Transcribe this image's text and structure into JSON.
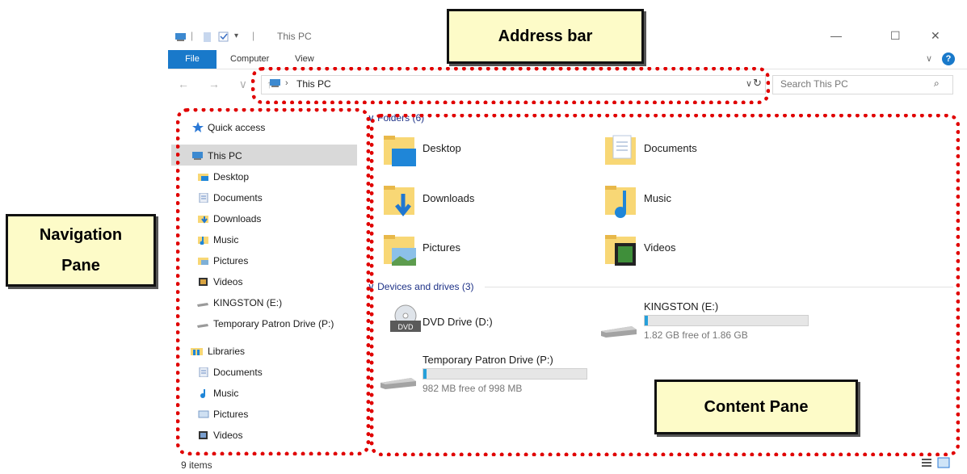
{
  "window": {
    "title": "This PC",
    "ribbon_tabs": [
      "File",
      "Computer",
      "View"
    ],
    "address_path": "This PC",
    "search_placeholder": "Search This PC"
  },
  "nav": {
    "quick_access": "Quick access",
    "this_pc": "This PC",
    "items": [
      "Desktop",
      "Documents",
      "Downloads",
      "Music",
      "Pictures",
      "Videos",
      "KINGSTON (E:)",
      "Temporary Patron Drive (P:)"
    ],
    "libraries": "Libraries",
    "library_items": [
      "Documents",
      "Music",
      "Pictures",
      "Videos"
    ]
  },
  "content": {
    "folders_header": "Folders (6)",
    "folders": [
      "Desktop",
      "Documents",
      "Downloads",
      "Music",
      "Pictures",
      "Videos"
    ],
    "drives_header": "Devices and drives (3)",
    "drives": [
      {
        "name": "DVD Drive (D:)",
        "icon_label": "DVD"
      },
      {
        "name": "KINGSTON (E:)",
        "free": "1.82 GB free of 1.86 GB",
        "used_fraction": 0.02
      },
      {
        "name": "Temporary Patron Drive (P:)",
        "free": "982 MB free of 998 MB",
        "used_fraction": 0.02
      }
    ]
  },
  "status": {
    "items": "9 items"
  },
  "callouts": {
    "address_bar": "Address bar",
    "navigation_pane_line1": "Navigation",
    "navigation_pane_line2": "Pane",
    "content_pane": "Content Pane"
  },
  "colors": {
    "accent": "#1979ca",
    "folder": "#f8d775",
    "annotation": "#e00000",
    "callout_bg": "#fdfbc8"
  }
}
